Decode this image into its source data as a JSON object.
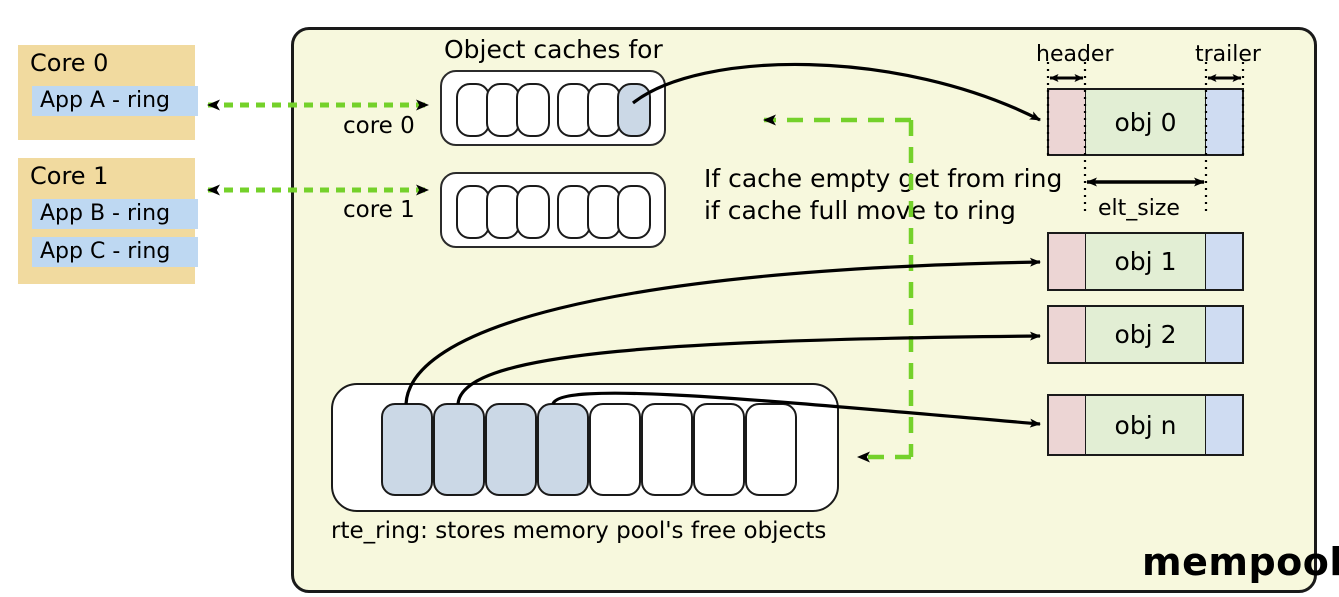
{
  "diagram": {
    "container_label": "mempool",
    "caches_title": "Object caches for",
    "core_labels": [
      "core 0",
      "core 1"
    ],
    "note_line1": "If cache empty get from ring",
    "note_line2": "if cache full move to ring",
    "ring_caption": "rte_ring: stores memory pool's free objects",
    "header_label": "header",
    "trailer_label": "trailer",
    "elt_size_label": "elt_size"
  },
  "cores": [
    {
      "title": "Core 0",
      "apps": [
        "App A - ring"
      ]
    },
    {
      "title": "Core 1",
      "apps": [
        "App B - ring",
        "App C - ring"
      ]
    }
  ],
  "caches": [
    {
      "core": "core 0",
      "slots": [
        "empty",
        "empty",
        "empty",
        "empty",
        "empty",
        "filled"
      ]
    },
    {
      "core": "core 1",
      "slots": [
        "empty",
        "empty",
        "empty",
        "empty",
        "empty",
        "empty"
      ]
    }
  ],
  "ring": {
    "slots": [
      "filled",
      "filled",
      "filled",
      "filled",
      "empty",
      "empty",
      "empty",
      "empty"
    ],
    "filled_count": 4,
    "total_count": 8
  },
  "objects": [
    {
      "name": "obj 0"
    },
    {
      "name": "obj 1"
    },
    {
      "name": "obj 2"
    },
    {
      "name": "obj n"
    }
  ],
  "colors": {
    "mempool_bg": "#f7f8dd",
    "core_box": "#f1da9f",
    "app_strip": "#bed8f2",
    "slot_filled": "#cbd8e6",
    "obj_header": "#ecd5d4",
    "obj_body": "#e2eed4",
    "obj_trailer": "#cfdcf2",
    "dashed_arrow": "#74d12a",
    "solid_arrow": "#000000"
  }
}
